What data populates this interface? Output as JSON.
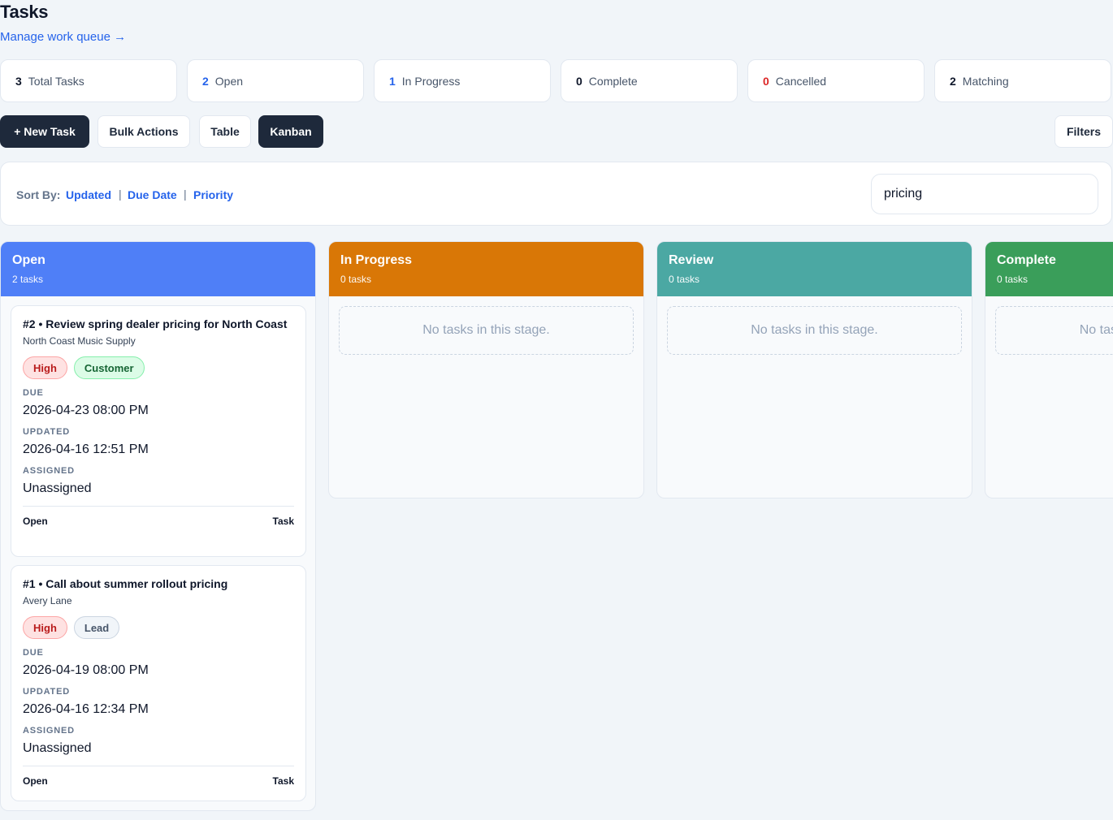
{
  "header": {
    "title": "Tasks",
    "manage_link": "Manage work queue →"
  },
  "stats": [
    {
      "value": "3",
      "label": "Total Tasks"
    },
    {
      "value": "2",
      "label": "Open"
    },
    {
      "value": "1",
      "label": "In Progress"
    },
    {
      "value": "0",
      "label": "Complete"
    },
    {
      "value": "0",
      "label": "Cancelled"
    },
    {
      "value": "2",
      "label": "Matching"
    }
  ],
  "toolbar": {
    "new_task": "+ New Task",
    "bulk_actions": "Bulk Actions",
    "table": "Table",
    "kanban": "Kanban",
    "filters": "Filters"
  },
  "sort": {
    "label": "Sort By:",
    "options": [
      "Updated",
      "Due Date",
      "Priority"
    ],
    "separator": "|",
    "search_value": "pricing"
  },
  "columns": [
    {
      "title": "Open",
      "count": "2 tasks",
      "color": "#4f7ff7"
    },
    {
      "title": "In Progress",
      "count": "0 tasks",
      "color": "#d97706",
      "empty": "No tasks in this stage."
    },
    {
      "title": "Review",
      "count": "0 tasks",
      "color": "#4ba8a3",
      "empty": "No tasks in this stage."
    },
    {
      "title": "Complete",
      "count": "0 tasks",
      "color": "#3a9e5a",
      "empty": "No tasks in this stage."
    }
  ],
  "field_labels": {
    "due": "DUE",
    "updated": "UPDATED",
    "assigned": "ASSIGNED"
  },
  "cards": [
    {
      "title": "#2 • Review spring dealer pricing for North Coast",
      "subtitle": "North Coast Music Supply",
      "priority": "High",
      "tag": "Customer",
      "due": "2026-04-23 08:00 PM",
      "updated": "2026-04-16 12:51 PM",
      "assigned": "Unassigned",
      "status": "Open",
      "type": "Task"
    },
    {
      "title": "#1 • Call about summer rollout pricing",
      "subtitle": "Avery Lane",
      "priority": "High",
      "tag": "Lead",
      "due": "2026-04-19 08:00 PM",
      "updated": "2026-04-16 12:34 PM",
      "assigned": "Unassigned",
      "status": "Open",
      "type": "Task"
    }
  ]
}
